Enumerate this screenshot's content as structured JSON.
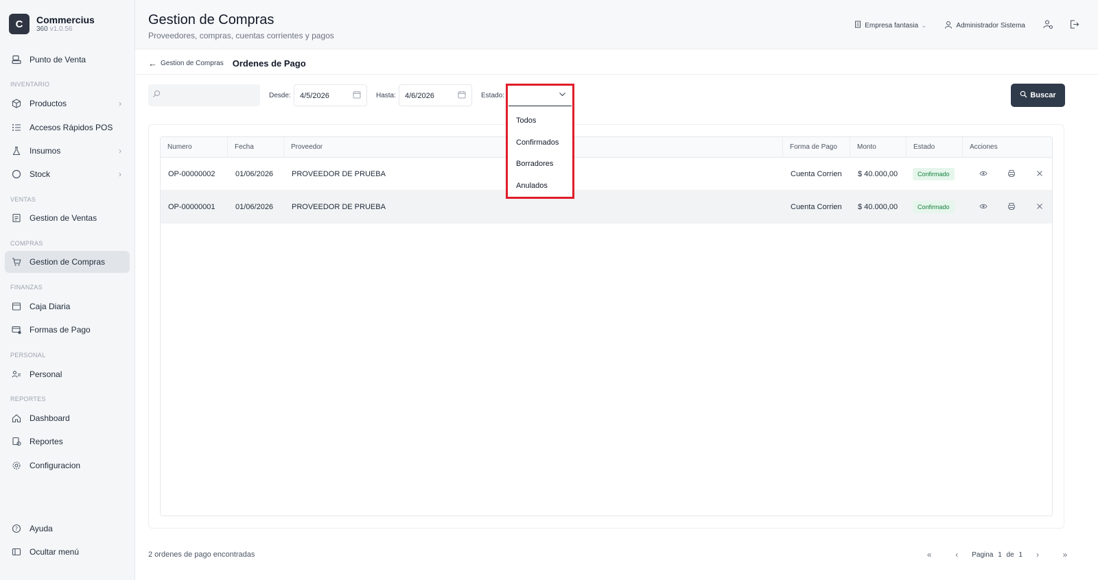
{
  "app": {
    "logo_letter": "C",
    "name": "Commercius",
    "edition": "360",
    "version": "v1.0.56"
  },
  "sidebar": {
    "top_item": {
      "label": "Punto de Venta",
      "icon": "pos-terminal-icon"
    },
    "sections": {
      "inventario": "INVENTARIO",
      "ventas": "VENTAS",
      "compras": "COMPRAS",
      "finanzas": "FINANZAS",
      "personal": "PERSONAL",
      "reportes": "REPORTES"
    },
    "items": {
      "productos": "Productos",
      "accesos": "Accesos Rápidos POS",
      "insumos": "Insumos",
      "stock": "Stock",
      "gestion_ventas": "Gestion de Ventas",
      "gestion_compras": "Gestion de Compras",
      "caja_diaria": "Caja Diaria",
      "formas_pago": "Formas de Pago",
      "personal": "Personal",
      "dashboard": "Dashboard",
      "reportes": "Reportes",
      "configuracion": "Configuracion",
      "ayuda": "Ayuda",
      "ocultar": "Ocultar menú"
    }
  },
  "header": {
    "title": "Gestion de Compras",
    "subtitle": "Proveedores, compras, cuentas corrientes y pagos",
    "company": "Empresa fantasia",
    "user": "Administrador Sistema"
  },
  "breadcrumb": {
    "back": "Gestion de Compras",
    "current": "Ordenes de Pago"
  },
  "filters": {
    "search_value": "",
    "desde_label": "Desde:",
    "desde_value": "4/5/2026",
    "hasta_label": "Hasta:",
    "hasta_value": "4/6/2026",
    "estado_label": "Estado:",
    "estado_value": "",
    "estado_options": [
      "Todos",
      "Confirmados",
      "Borradores",
      "Anulados"
    ],
    "search_button": "Buscar"
  },
  "table": {
    "columns": [
      "Numero",
      "Fecha",
      "Proveedor",
      "Forma de Pago",
      "Monto",
      "Estado",
      "Acciones"
    ],
    "rows": [
      {
        "numero": "OP-00000002",
        "fecha": "01/06/2026",
        "proveedor": "PROVEEDOR DE PRUEBA",
        "forma_pago": "Cuenta Corrien",
        "monto": "$ 40.000,00",
        "estado": "Confirmado"
      },
      {
        "numero": "OP-00000001",
        "fecha": "01/06/2026",
        "proveedor": "PROVEEDOR DE PRUEBA",
        "forma_pago": "Cuenta Corrien",
        "monto": "$ 40.000,00",
        "estado": "Confirmado"
      }
    ]
  },
  "footer": {
    "count_text": "2 ordenes de pago encontradas",
    "page_label": "Pagina",
    "page_current": "1",
    "page_of": "de",
    "page_total": "1"
  },
  "colors": {
    "accent": "#2f3a4a",
    "highlight": "#e11d2a",
    "badge_bg": "#e6f6ec",
    "badge_text": "#15803d"
  }
}
